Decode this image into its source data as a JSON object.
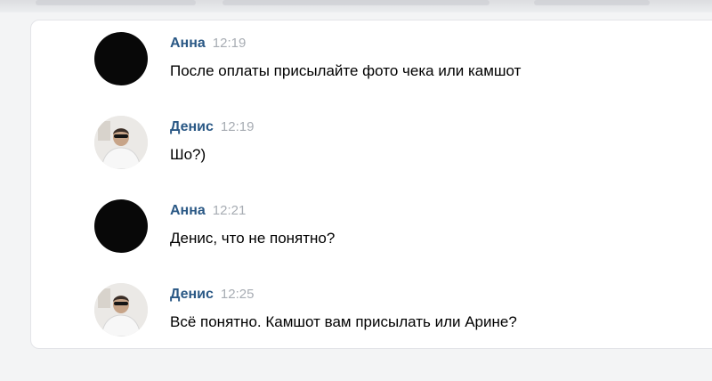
{
  "messages": [
    {
      "author": "Анна",
      "time": "12:19",
      "text": "После оплаты присылайте фото чека или камшот",
      "avatar": "dark"
    },
    {
      "author": "Денис",
      "time": "12:19",
      "text": "Шо?)",
      "avatar": "photo"
    },
    {
      "author": "Анна",
      "time": "12:21",
      "text": "Денис, что не понятно?",
      "avatar": "dark"
    },
    {
      "author": "Денис",
      "time": "12:25",
      "text": "Всё понятно. Камшот вам присылать или Арине?",
      "avatar": "photo"
    }
  ],
  "colors": {
    "author": "#2a5885",
    "time": "#a7acb3",
    "text": "#000000",
    "background": "#f3f4f5",
    "panel": "#ffffff"
  }
}
